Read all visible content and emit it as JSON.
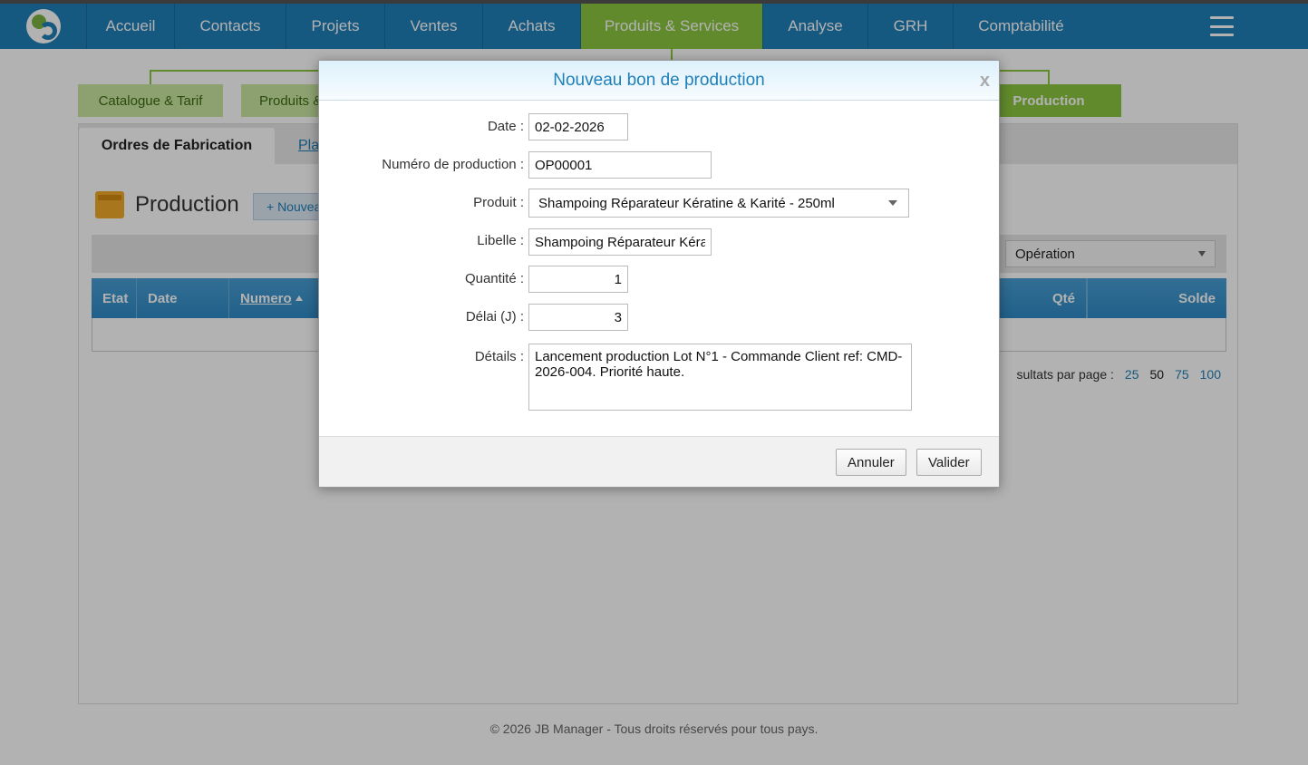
{
  "nav": {
    "items": [
      {
        "label": "Accueil"
      },
      {
        "label": "Contacts"
      },
      {
        "label": "Projets"
      },
      {
        "label": "Ventes"
      },
      {
        "label": "Achats"
      },
      {
        "label": "Produits & Services",
        "active": true
      },
      {
        "label": "Analyse"
      },
      {
        "label": "GRH"
      },
      {
        "label": "Comptabilité"
      }
    ],
    "menu_icon": "hamburger-menu-icon",
    "accent": "#1f7fb8",
    "active_color": "#8cc63f"
  },
  "subtabs": {
    "catalogue": "Catalogue & Tarif",
    "produits": "Produits &",
    "production": "Production"
  },
  "panel": {
    "tab_active": "Ordres de Fabrication",
    "tab_link": "Pla",
    "title": "Production",
    "new_button": "+ Nouvea",
    "operation_select": "Opération",
    "columns": {
      "etat": "Etat",
      "date": "Date",
      "numero": "Numero",
      "qte": "Qté",
      "solde": "Solde"
    },
    "per_page_label": "sultats par page :",
    "per_page_options": [
      "25",
      "50",
      "75",
      "100"
    ],
    "per_page_selected": "50"
  },
  "dialog": {
    "title": "Nouveau bon de production",
    "close": "x",
    "labels": {
      "date": "Date :",
      "numero": "Numéro de production :",
      "produit": "Produit :",
      "libelle": "Libelle :",
      "quantite": "Quantité :",
      "delai": "Délai (J) :",
      "details": "Détails :"
    },
    "values": {
      "date": "02-02-2026",
      "numero": "OP00001",
      "produit": "Shampoing Réparateur Kératine & Karité - 250ml",
      "libelle": "Shampoing Réparateur Kéra",
      "quantite": "1",
      "delai": "3",
      "details": "Lancement production Lot N°1 - Commande Client ref: CMD-2026-004. Priorité haute."
    },
    "buttons": {
      "cancel": "Annuler",
      "ok": "Valider"
    }
  },
  "footer": "© 2026 JB Manager - Tous droits réservés pour tous pays."
}
